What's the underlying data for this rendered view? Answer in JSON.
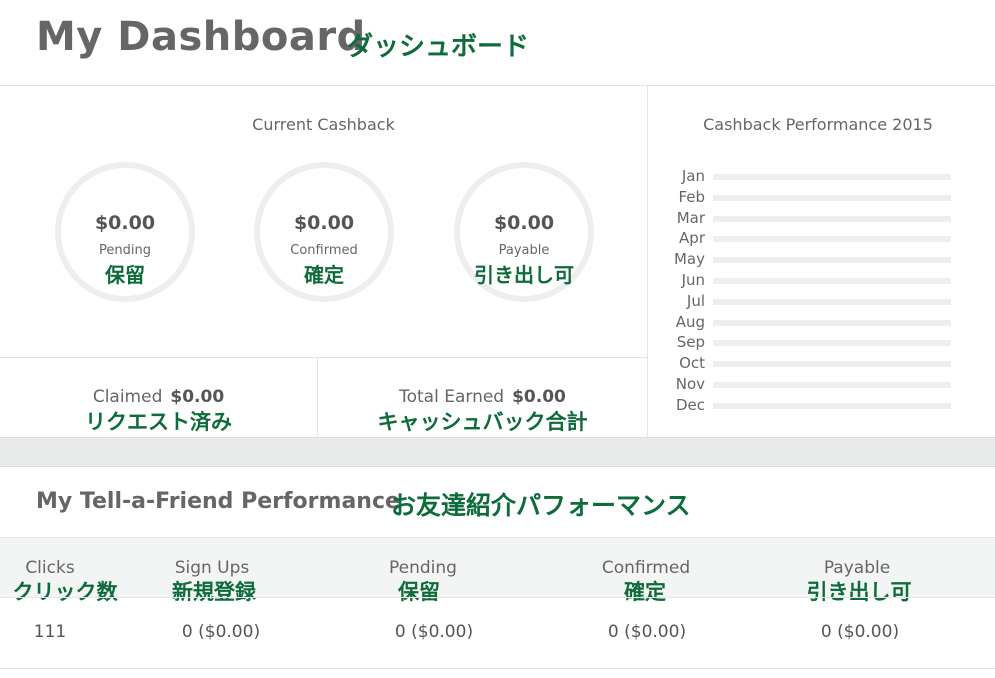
{
  "header": {
    "title": "My Dashboard",
    "title_jp": "ダッシュボード"
  },
  "cashback": {
    "title": "Current Cashback",
    "circles": [
      {
        "amount": "$0.00",
        "label": "Pending",
        "label_jp": "保留"
      },
      {
        "amount": "$0.00",
        "label": "Confirmed",
        "label_jp": "確定"
      },
      {
        "amount": "$0.00",
        "label": "Payable",
        "label_jp": "引き出し可"
      }
    ],
    "claimed": {
      "label": "Claimed",
      "value": "$0.00",
      "label_jp": "リクエスト済み"
    },
    "total_earned": {
      "label": "Total Earned",
      "value": "$0.00",
      "label_jp": "キャッシュバック合計"
    }
  },
  "performance": {
    "title": "Cashback Performance 2015",
    "months": [
      "Jan",
      "Feb",
      "Mar",
      "Apr",
      "May",
      "Jun",
      "Jul",
      "Aug",
      "Sep",
      "Oct",
      "Nov",
      "Dec"
    ]
  },
  "tell_a_friend": {
    "title": "My Tell-a-Friend Performance",
    "title_jp": "お友達紹介パフォーマンス",
    "columns": [
      {
        "label": "Clicks",
        "label_jp": "クリック数"
      },
      {
        "label": "Sign Ups",
        "label_jp": "新規登録"
      },
      {
        "label": "Pending",
        "label_jp": "保留"
      },
      {
        "label": "Confirmed",
        "label_jp": "確定"
      },
      {
        "label": "Payable",
        "label_jp": "引き出し可"
      }
    ],
    "row": [
      "111",
      "0 ($0.00)",
      "0 ($0.00)",
      "0 ($0.00)",
      "0 ($0.00)"
    ]
  },
  "colors": {
    "annotation": "#0e6b3a",
    "ring": "#eeeeee",
    "strip": "#e9eaea"
  }
}
